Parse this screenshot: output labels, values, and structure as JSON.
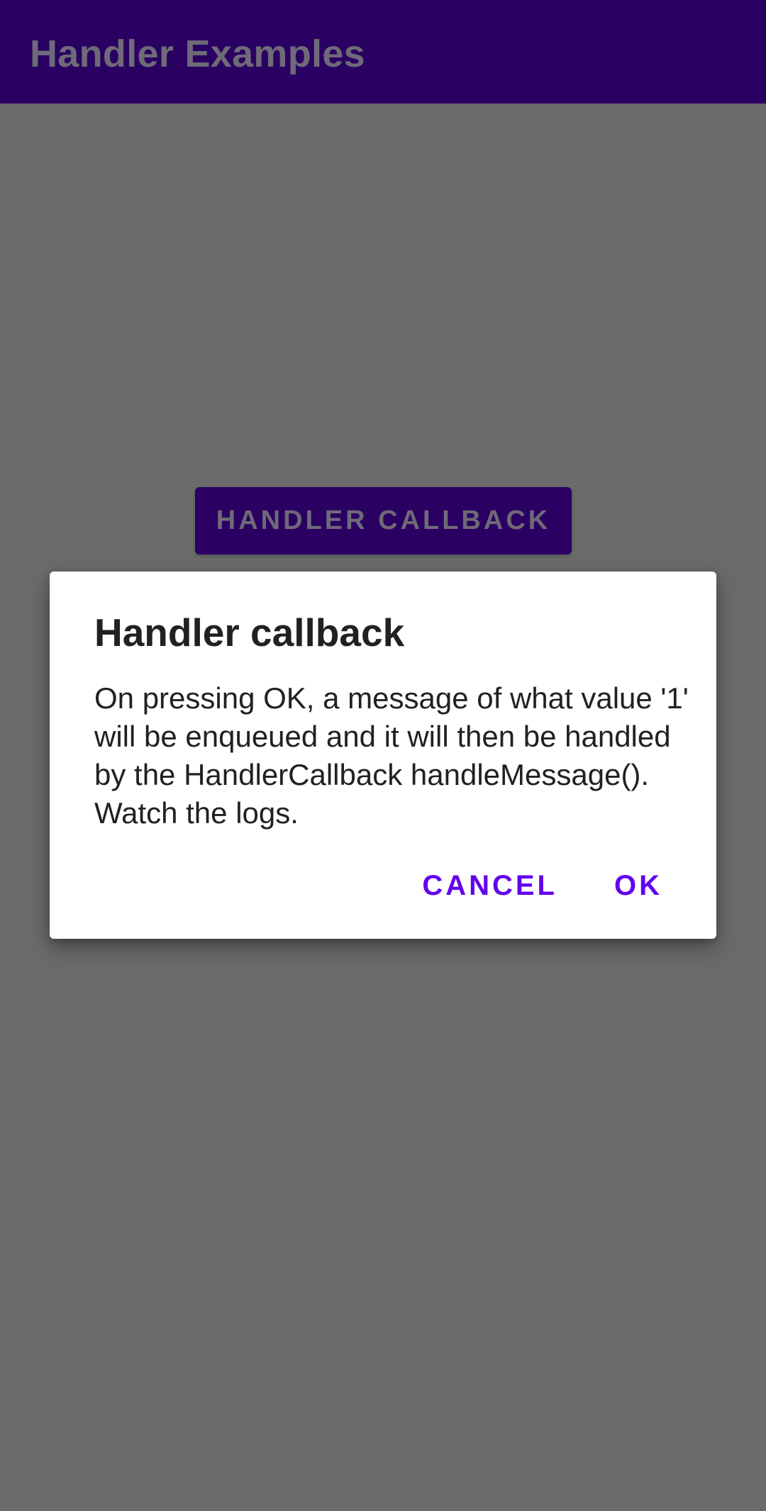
{
  "app_bar": {
    "title": "Handler Examples",
    "background": "#2a0063"
  },
  "main": {
    "button_label": "HANDLER CALLBACK"
  },
  "dialog": {
    "title": "Handler callback",
    "message": "On pressing OK, a message of what value '1' will be enqueued and it will then be handled by the HandlerCallback handleMessage(). Watch the logs.",
    "cancel_label": "CANCEL",
    "ok_label": "OK",
    "accent": "#6200ee"
  },
  "scrim_color": "#6b6b6b"
}
